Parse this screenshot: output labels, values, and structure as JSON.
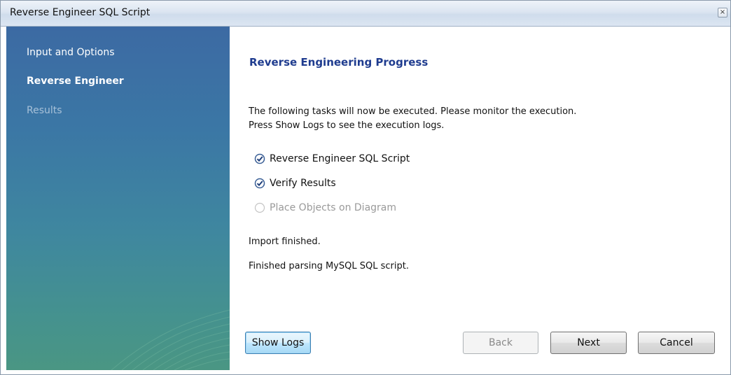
{
  "window": {
    "title": "Reverse Engineer SQL Script",
    "close_icon": "close-icon"
  },
  "sidebar": {
    "items": [
      {
        "label": "Input and Options",
        "state": "done"
      },
      {
        "label": "Reverse Engineer",
        "state": "current"
      },
      {
        "label": "Results",
        "state": "pending"
      }
    ]
  },
  "main": {
    "heading": "Reverse Engineering Progress",
    "description_line1": "The following tasks will now be executed. Please monitor the execution.",
    "description_line2": "Press Show Logs to see the execution logs.",
    "tasks": [
      {
        "label": "Reverse Engineer SQL Script",
        "status": "done",
        "icon": "check-circle-icon"
      },
      {
        "label": "Verify Results",
        "status": "done",
        "icon": "check-circle-icon"
      },
      {
        "label": "Place Objects on Diagram",
        "status": "pending",
        "icon": "empty-circle-icon"
      }
    ],
    "status_lines": [
      "Import finished.",
      "Finished parsing MySQL SQL script."
    ]
  },
  "buttons": {
    "show_logs": "Show Logs",
    "back": "Back",
    "next": "Next",
    "cancel": "Cancel"
  },
  "colors": {
    "heading": "#1f3c8f",
    "sidebar_top": "#3c6aa3",
    "sidebar_bottom": "#4a9683",
    "disabled_text": "#9a9a9a"
  }
}
